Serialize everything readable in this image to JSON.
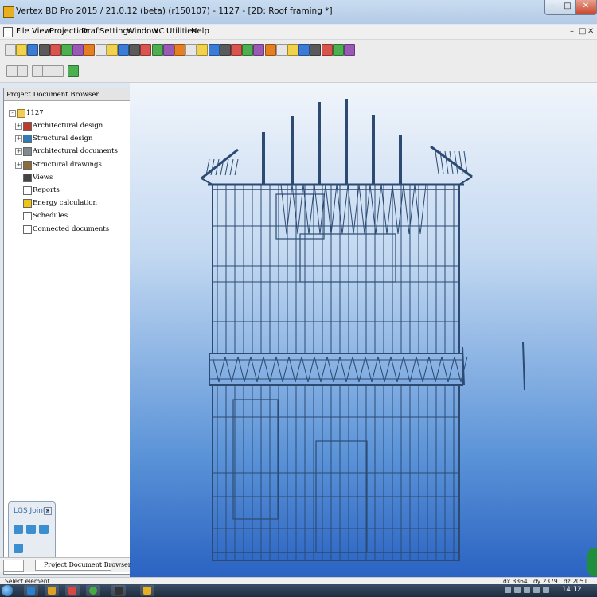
{
  "window": {
    "title": "Vertex BD Pro 2015 / 21.0.12 (beta) (r150107) - 1127 - [2D: Roof framing *]",
    "min_label": "–",
    "max_label": "□",
    "close_label": "✕"
  },
  "menu": {
    "items": [
      {
        "label": "File"
      },
      {
        "label": "View"
      },
      {
        "label": "Projection"
      },
      {
        "label": "Draft"
      },
      {
        "label": "Settings"
      },
      {
        "label": "Window"
      },
      {
        "label": "NC"
      },
      {
        "label": "Utilities"
      },
      {
        "label": "Help"
      }
    ],
    "mdi_min": "–",
    "mdi_restore": "□",
    "mdi_close": "✕"
  },
  "toolbar_icons": [
    "new-file-icon",
    "open-folder-icon",
    "save-icon",
    "print-icon",
    "export-icon",
    "layers-icon",
    "eraser-icon",
    "select-icon",
    "wall-icon",
    "frame-icon",
    "grid-icon",
    "window-icon",
    "door-icon",
    "settings-icon",
    "panel-icon",
    "green-grid-icon",
    "wall-tool-icon",
    "roof-icon",
    "hatch-icon",
    "dimension-icon",
    "note-icon",
    "text-icon",
    "sheet-icon",
    "table-icon",
    "3d-icon",
    "list-icon",
    "stud-icon",
    "joist-icon",
    "truss-icon",
    "beam-icon",
    "render-icon"
  ],
  "toolbar2_icons": [
    "pointer-icon",
    "edit-point-icon",
    "zoom-icon",
    "zoom-window-icon",
    "zoom-extents-icon",
    "refresh-icon"
  ],
  "project_browser": {
    "title": "Project Document Browser",
    "root": "1127",
    "items": [
      {
        "label": "Architectural design",
        "expandable": true,
        "icon": "architectural-design-icon"
      },
      {
        "label": "Structural design",
        "expandable": true,
        "icon": "structural-design-icon"
      },
      {
        "label": "Architectural documents",
        "expandable": true,
        "icon": "architectural-documents-icon"
      },
      {
        "label": "Structural drawings",
        "expandable": true,
        "icon": "structural-drawings-icon"
      },
      {
        "label": "Views",
        "expandable": false,
        "icon": "views-icon"
      },
      {
        "label": "Reports",
        "expandable": false,
        "icon": "reports-icon"
      },
      {
        "label": "Energy calculation",
        "expandable": false,
        "icon": "energy-calculation-icon"
      },
      {
        "label": "Schedules",
        "expandable": false,
        "icon": "schedules-icon"
      },
      {
        "label": "Connected documents",
        "expandable": false,
        "icon": "connected-documents-icon"
      }
    ],
    "expand_symbol": "+"
  },
  "lgs_joints": {
    "title": "LGS Joints",
    "close_label": "✕",
    "joints": [
      "joint-l-icon",
      "joint-t-icon",
      "joint-corner-icon",
      "joint-cross-icon"
    ]
  },
  "tabs": [
    {
      "label": ""
    },
    {
      "label": "Project Document Browser"
    }
  ],
  "status": {
    "left": "Select element",
    "dx": "dx 3364",
    "dy": "dy 2379",
    "dz": "dz 2051"
  },
  "taskbar": {
    "clock": "14:12"
  },
  "colors": {
    "viewport_top": "#f1f5fb",
    "viewport_bottom": "#2a63c2",
    "framing": "#2c4a72",
    "lgs_accent": "#3b8fd0"
  }
}
